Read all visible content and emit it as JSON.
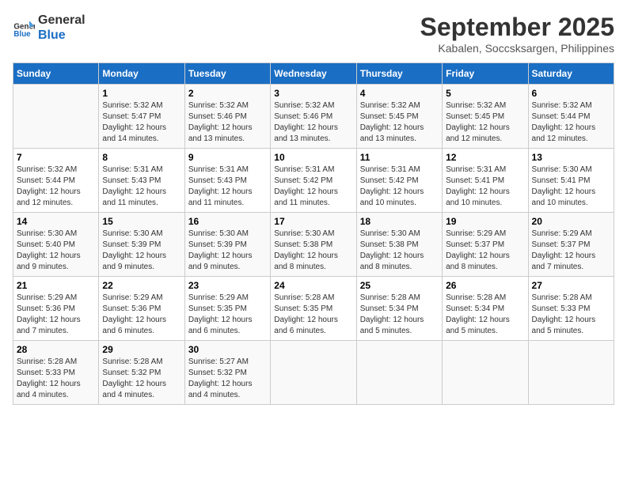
{
  "logo": {
    "line1": "General",
    "line2": "Blue"
  },
  "title": "September 2025",
  "subtitle": "Kabalen, Soccsksargen, Philippines",
  "days_header": [
    "Sunday",
    "Monday",
    "Tuesday",
    "Wednesday",
    "Thursday",
    "Friday",
    "Saturday"
  ],
  "weeks": [
    [
      {
        "day": "",
        "info": ""
      },
      {
        "day": "1",
        "info": "Sunrise: 5:32 AM\nSunset: 5:47 PM\nDaylight: 12 hours\nand 14 minutes."
      },
      {
        "day": "2",
        "info": "Sunrise: 5:32 AM\nSunset: 5:46 PM\nDaylight: 12 hours\nand 13 minutes."
      },
      {
        "day": "3",
        "info": "Sunrise: 5:32 AM\nSunset: 5:46 PM\nDaylight: 12 hours\nand 13 minutes."
      },
      {
        "day": "4",
        "info": "Sunrise: 5:32 AM\nSunset: 5:45 PM\nDaylight: 12 hours\nand 13 minutes."
      },
      {
        "day": "5",
        "info": "Sunrise: 5:32 AM\nSunset: 5:45 PM\nDaylight: 12 hours\nand 12 minutes."
      },
      {
        "day": "6",
        "info": "Sunrise: 5:32 AM\nSunset: 5:44 PM\nDaylight: 12 hours\nand 12 minutes."
      }
    ],
    [
      {
        "day": "7",
        "info": "Sunrise: 5:32 AM\nSunset: 5:44 PM\nDaylight: 12 hours\nand 12 minutes."
      },
      {
        "day": "8",
        "info": "Sunrise: 5:31 AM\nSunset: 5:43 PM\nDaylight: 12 hours\nand 11 minutes."
      },
      {
        "day": "9",
        "info": "Sunrise: 5:31 AM\nSunset: 5:43 PM\nDaylight: 12 hours\nand 11 minutes."
      },
      {
        "day": "10",
        "info": "Sunrise: 5:31 AM\nSunset: 5:42 PM\nDaylight: 12 hours\nand 11 minutes."
      },
      {
        "day": "11",
        "info": "Sunrise: 5:31 AM\nSunset: 5:42 PM\nDaylight: 12 hours\nand 10 minutes."
      },
      {
        "day": "12",
        "info": "Sunrise: 5:31 AM\nSunset: 5:41 PM\nDaylight: 12 hours\nand 10 minutes."
      },
      {
        "day": "13",
        "info": "Sunrise: 5:30 AM\nSunset: 5:41 PM\nDaylight: 12 hours\nand 10 minutes."
      }
    ],
    [
      {
        "day": "14",
        "info": "Sunrise: 5:30 AM\nSunset: 5:40 PM\nDaylight: 12 hours\nand 9 minutes."
      },
      {
        "day": "15",
        "info": "Sunrise: 5:30 AM\nSunset: 5:39 PM\nDaylight: 12 hours\nand 9 minutes."
      },
      {
        "day": "16",
        "info": "Sunrise: 5:30 AM\nSunset: 5:39 PM\nDaylight: 12 hours\nand 9 minutes."
      },
      {
        "day": "17",
        "info": "Sunrise: 5:30 AM\nSunset: 5:38 PM\nDaylight: 12 hours\nand 8 minutes."
      },
      {
        "day": "18",
        "info": "Sunrise: 5:30 AM\nSunset: 5:38 PM\nDaylight: 12 hours\nand 8 minutes."
      },
      {
        "day": "19",
        "info": "Sunrise: 5:29 AM\nSunset: 5:37 PM\nDaylight: 12 hours\nand 8 minutes."
      },
      {
        "day": "20",
        "info": "Sunrise: 5:29 AM\nSunset: 5:37 PM\nDaylight: 12 hours\nand 7 minutes."
      }
    ],
    [
      {
        "day": "21",
        "info": "Sunrise: 5:29 AM\nSunset: 5:36 PM\nDaylight: 12 hours\nand 7 minutes."
      },
      {
        "day": "22",
        "info": "Sunrise: 5:29 AM\nSunset: 5:36 PM\nDaylight: 12 hours\nand 6 minutes."
      },
      {
        "day": "23",
        "info": "Sunrise: 5:29 AM\nSunset: 5:35 PM\nDaylight: 12 hours\nand 6 minutes."
      },
      {
        "day": "24",
        "info": "Sunrise: 5:28 AM\nSunset: 5:35 PM\nDaylight: 12 hours\nand 6 minutes."
      },
      {
        "day": "25",
        "info": "Sunrise: 5:28 AM\nSunset: 5:34 PM\nDaylight: 12 hours\nand 5 minutes."
      },
      {
        "day": "26",
        "info": "Sunrise: 5:28 AM\nSunset: 5:34 PM\nDaylight: 12 hours\nand 5 minutes."
      },
      {
        "day": "27",
        "info": "Sunrise: 5:28 AM\nSunset: 5:33 PM\nDaylight: 12 hours\nand 5 minutes."
      }
    ],
    [
      {
        "day": "28",
        "info": "Sunrise: 5:28 AM\nSunset: 5:33 PM\nDaylight: 12 hours\nand 4 minutes."
      },
      {
        "day": "29",
        "info": "Sunrise: 5:28 AM\nSunset: 5:32 PM\nDaylight: 12 hours\nand 4 minutes."
      },
      {
        "day": "30",
        "info": "Sunrise: 5:27 AM\nSunset: 5:32 PM\nDaylight: 12 hours\nand 4 minutes."
      },
      {
        "day": "",
        "info": ""
      },
      {
        "day": "",
        "info": ""
      },
      {
        "day": "",
        "info": ""
      },
      {
        "day": "",
        "info": ""
      }
    ]
  ]
}
